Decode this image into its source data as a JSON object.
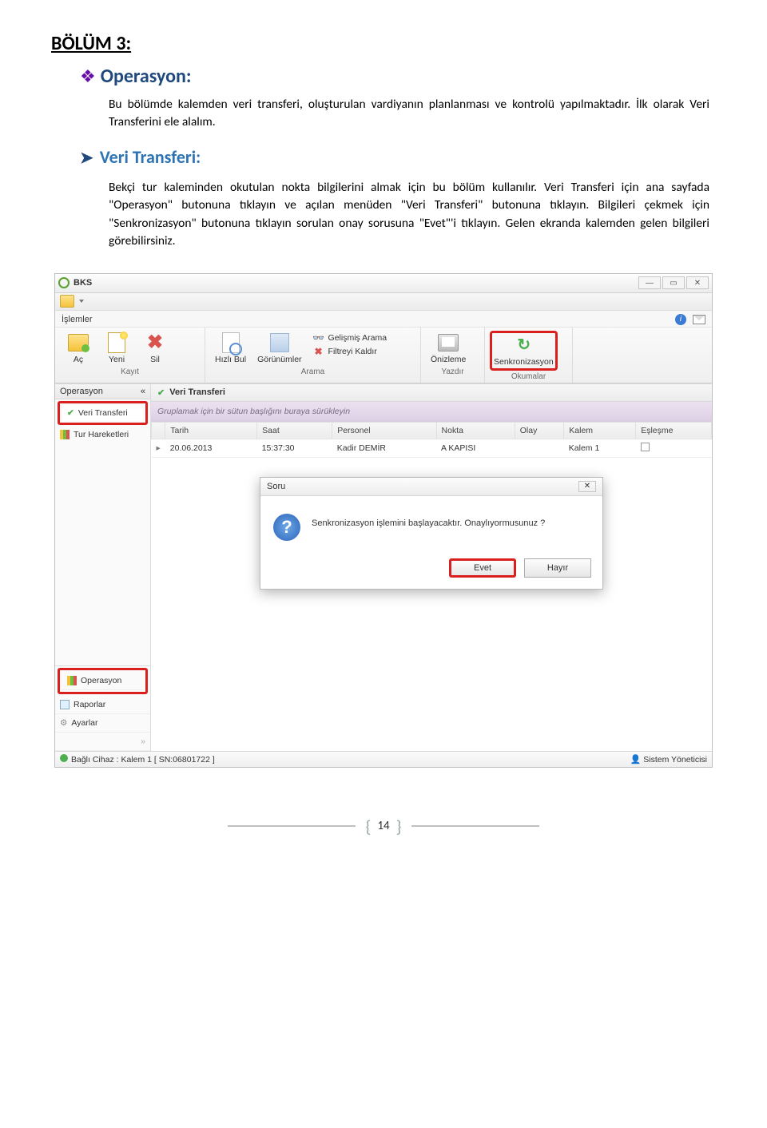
{
  "doc": {
    "section_title": "BÖLÜM 3:",
    "operasyon_head": "Operasyon:",
    "intro": "Bu bölümde kalemden veri transferi, oluşturulan vardiyanın planlanması ve kontrolü yapılmaktadır. İlk olarak Veri Transferini ele alalım.",
    "veri_head": "Veri Transferi:",
    "body": "Bekçi tur kaleminden okutulan nokta bilgilerini almak için bu bölüm kullanılır. Veri Transferi için ana sayfada \"Operasyon\" butonuna tıklayın ve açılan menüden \"Veri Transferi\" butonuna tıklayın. Bilgileri çekmek için \"Senkronizasyon\" butonuna tıklayın sorulan onay sorusuna \"Evet\"'i tıklayın. Gelen ekranda kalemden gelen bilgileri görebilirsiniz."
  },
  "app": {
    "title": "BKS",
    "ribbon_tab": "İşlemler",
    "groups": {
      "kayit": {
        "title": "Kayıt",
        "open": "Aç",
        "new": "Yeni",
        "del": "Sil"
      },
      "arama": {
        "title": "Arama",
        "quick": "Hızlı Bul",
        "views": "Görünümler",
        "adv": "Gelişmiş Arama",
        "clear": "Filtreyi Kaldır"
      },
      "yazdir": {
        "title": "Yazdır",
        "preview": "Önizleme"
      },
      "okumalar": {
        "title": "Okumalar",
        "sync": "Senkronizasyon"
      }
    },
    "sidebar": {
      "operasyon_head": "Operasyon",
      "veri_transferi": "Veri Transferi",
      "tur_hareketleri": "Tur Hareketleri",
      "operasyon": "Operasyon",
      "raporlar": "Raporlar",
      "ayarlar": "Ayarlar"
    },
    "main": {
      "title": "Veri Transferi",
      "group_hint": "Gruplamak için bir sütun başlığını buraya sürükleyin",
      "cols": {
        "tarih": "Tarih",
        "saat": "Saat",
        "personel": "Personel",
        "nokta": "Nokta",
        "olay": "Olay",
        "kalem": "Kalem",
        "eslesme": "Eşleşme"
      },
      "row": {
        "tarih": "20.06.2013",
        "saat": "15:37:30",
        "personel": "Kadir DEMİR",
        "nokta": "A KAPISI",
        "olay": "",
        "kalem": "Kalem 1"
      }
    },
    "dialog": {
      "title": "Soru",
      "text": "Senkronizasyon işlemini başlayacaktır. Onaylıyormusunuz ?",
      "yes": "Evet",
      "no": "Hayır"
    },
    "status": {
      "left": "Bağlı Cihaz : Kalem 1 [ SN:06801722 ]",
      "right": "Sistem Yöneticisi"
    }
  },
  "page_number": "14"
}
